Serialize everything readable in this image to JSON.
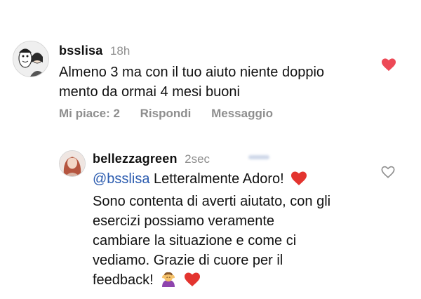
{
  "comment1": {
    "username": "bsslisa",
    "time": "18h",
    "text_line1": "Almeno 3 ma con il tuo aiuto niente doppio",
    "text_line2": "mento da ormai 4 mesi buoni",
    "likes_label": "Mi piace: 2",
    "reply_label": "Rispondi",
    "message_label": "Messaggio",
    "liked": true,
    "heart_color": "#ed4956"
  },
  "reply": {
    "username": "bellezzagreen",
    "time": "2sec",
    "mention": "@bsslisa",
    "line1_rest": " Letteralmente Adoro!",
    "line2": "Sono contenta di averti aiutato, con gli",
    "line3": "esercizi possiamo veramente",
    "line4": "cambiare la situazione e come ci",
    "line5": "vediamo. Grazie di cuore per il",
    "line6": "feedback!",
    "liked": false,
    "emoji_icons": [
      "red-heart-icon",
      "woman-getting-massage-icon",
      "red-heart-icon"
    ]
  },
  "colors": {
    "mention": "#2d5db0",
    "secondary_text": "#8e8e8e",
    "heart": "#ed4956"
  }
}
